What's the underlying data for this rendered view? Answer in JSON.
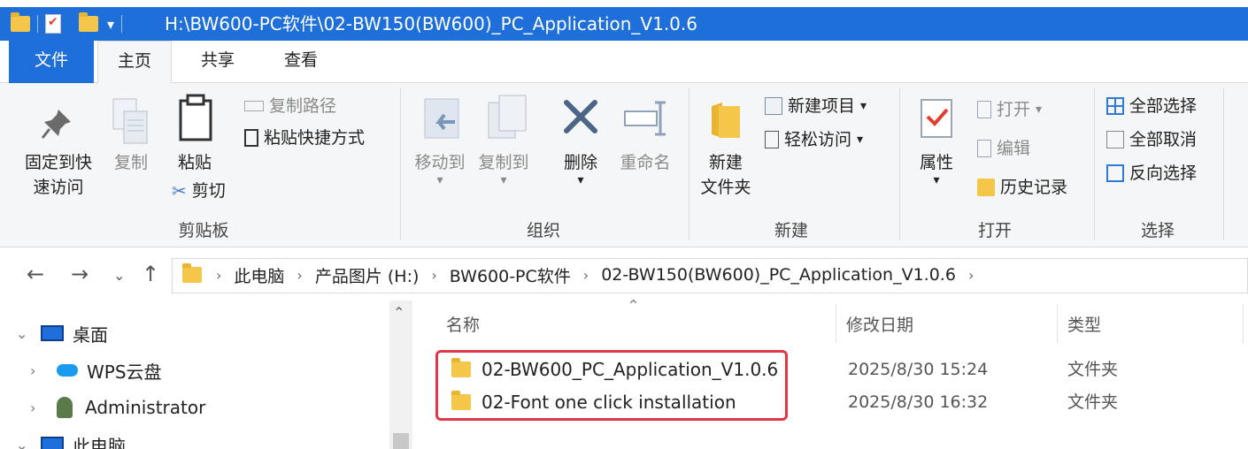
{
  "window": {
    "title": "H:\\BW600-PC软件\\02-BW150(BW600)_PC_Application_V1.0.6",
    "quick_access_dropdown": "▾"
  },
  "tabs": [
    {
      "label": "文件"
    },
    {
      "label": "主页"
    },
    {
      "label": "共享"
    },
    {
      "label": "查看"
    }
  ],
  "ribbon": {
    "clipboard": {
      "pin_label_1": "固定到快",
      "pin_label_2": "速访问",
      "copy_label": "复制",
      "paste_label": "粘贴",
      "copy_path_label": "复制路径",
      "paste_shortcut_label": "粘贴快捷方式",
      "cut_label": "剪切",
      "group_label": "剪贴板"
    },
    "organize": {
      "move_to_label": "移动到",
      "copy_to_label": "复制到",
      "delete_label": "删除",
      "rename_label": "重命名",
      "group_label": "组织"
    },
    "new": {
      "new_folder_label_1": "新建",
      "new_folder_label_2": "文件夹",
      "new_item_label": "新建项目",
      "easy_access_label": "轻松访问",
      "group_label": "新建"
    },
    "open": {
      "properties_label": "属性",
      "open_label": "打开",
      "edit_label": "编辑",
      "history_label": "历史记录",
      "group_label": "打开"
    },
    "select": {
      "select_all_label": "全部选择",
      "select_none_label": "全部取消",
      "invert_label": "反向选择",
      "group_label": "选择"
    }
  },
  "address": {
    "crumbs": [
      "此电脑",
      "产品图片 (H:)",
      "BW600-PC软件",
      "02-BW150(BW600)_PC_Application_V1.0.6"
    ]
  },
  "nav_pane": {
    "items": [
      {
        "label": "桌面",
        "expander": "⌄"
      },
      {
        "label": "WPS云盘",
        "expander": "›"
      },
      {
        "label": "Administrator",
        "expander": "›"
      },
      {
        "label": "此电脑",
        "expander": "⌄"
      }
    ]
  },
  "file_list": {
    "columns": {
      "name": "名称",
      "modified": "修改日期",
      "type": "类型"
    },
    "rows": [
      {
        "name": "02-BW600_PC_Application_V1.0.6",
        "modified": "2025/8/30 15:24",
        "type": "文件夹"
      },
      {
        "name": "02-Font one click installation",
        "modified": "2025/8/30 16:32",
        "type": "文件夹"
      }
    ]
  },
  "colors": {
    "accent": "#1e6fd9",
    "folder": "#f4c64a",
    "highlight": "#e0364a"
  }
}
